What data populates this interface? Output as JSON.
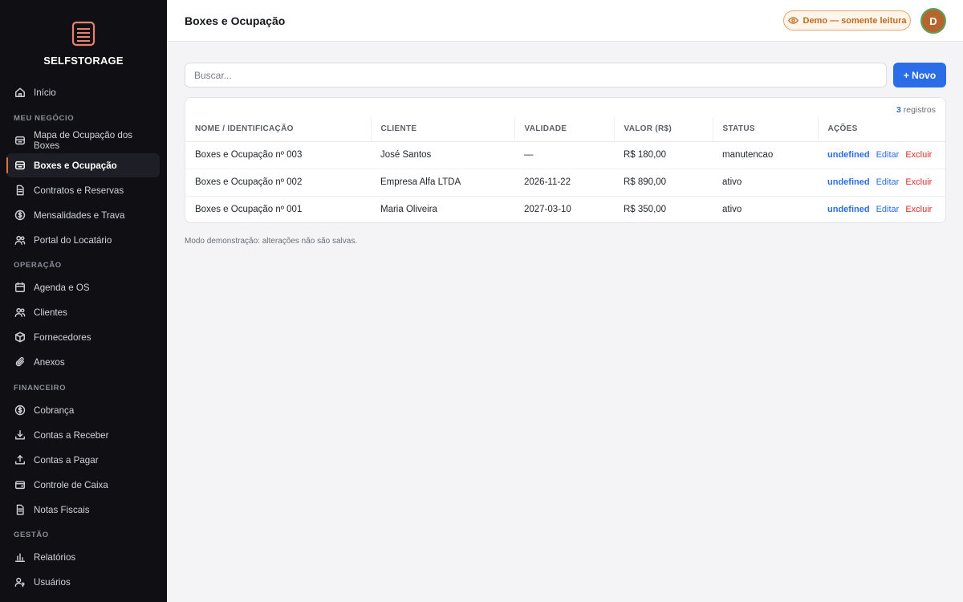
{
  "brand": {
    "name": "SELFSTORAGE",
    "logo_icon": "storage-box-icon",
    "accent": "#e0733a"
  },
  "sidebar": {
    "home": {
      "label": "Início",
      "icon": "home-icon"
    },
    "sections": [
      {
        "title": "MEU NEGÓCIO"
      },
      {
        "title": "OPERAÇÃO"
      },
      {
        "title": "FINANCEIRO"
      },
      {
        "title": "GESTÃO"
      }
    ],
    "items": [
      {
        "label": "Mapa de Ocupação dos Boxes",
        "icon": "box-icon"
      },
      {
        "label": "Boxes e Ocupação",
        "icon": "box-icon",
        "active": true
      },
      {
        "label": "Contratos e Reservas",
        "icon": "document-icon"
      },
      {
        "label": "Mensalidades e Trava",
        "icon": "dollar-circle-icon"
      },
      {
        "label": "Portal do Locatário",
        "icon": "users-icon"
      },
      {
        "label": "Agenda e OS",
        "icon": "calendar-icon"
      },
      {
        "label": "Clientes",
        "icon": "users-icon"
      },
      {
        "label": "Fornecedores",
        "icon": "package-icon"
      },
      {
        "label": "Anexos",
        "icon": "paperclip-icon"
      },
      {
        "label": "Cobrança",
        "icon": "dollar-circle-icon"
      },
      {
        "label": "Contas a Receber",
        "icon": "download-icon"
      },
      {
        "label": "Contas a Pagar",
        "icon": "upload-icon"
      },
      {
        "label": "Controle de Caixa",
        "icon": "wallet-icon"
      },
      {
        "label": "Notas Fiscais",
        "icon": "document-icon"
      },
      {
        "label": "Relatórios",
        "icon": "bar-chart-icon"
      },
      {
        "label": "Usuários",
        "icon": "user-key-icon"
      }
    ]
  },
  "header": {
    "title": "Boxes e Ocupação",
    "demo_badge": "Demo — somente leitura",
    "avatar_initial": "D"
  },
  "search": {
    "placeholder": "Buscar..."
  },
  "toolbar": {
    "new_label": "+ Novo"
  },
  "table": {
    "count": "3",
    "count_suffix": " registros",
    "columns": [
      "NOME / IDENTIFICAÇÃO",
      "CLIENTE",
      "VALIDADE",
      "VALOR (R$)",
      "STATUS",
      "AÇÕES"
    ],
    "rows": [
      {
        "name": "Boxes e Ocupação nº 003",
        "client": "José Santos",
        "validity": "—",
        "value": "R$ 180,00",
        "status": "manutencao"
      },
      {
        "name": "Boxes e Ocupação nº 002",
        "client": "Empresa Alfa LTDA",
        "validity": "2026-11-22",
        "value": "R$ 890,00",
        "status": "ativo"
      },
      {
        "name": "Boxes e Ocupação nº 001",
        "client": "Maria Oliveira",
        "validity": "2027-03-10",
        "value": "R$ 350,00",
        "status": "ativo"
      }
    ],
    "actions": {
      "undefined": "undefined",
      "edit": "Editar",
      "delete": "Excluir"
    }
  },
  "footnote": "Modo demonstração: alterações não são salvas."
}
